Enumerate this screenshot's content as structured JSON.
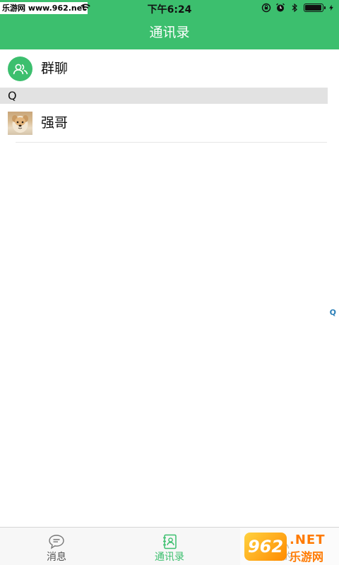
{
  "status_bar": {
    "watermark": "乐游网 www.962.net",
    "time": "下午6:24",
    "battery_level": 0.9,
    "icons": [
      "wifi-icon",
      "screen-rotation-lock-icon",
      "alarm-icon",
      "bluetooth-icon",
      "battery-icon",
      "charging-icon"
    ]
  },
  "header": {
    "title": "通讯录"
  },
  "group_chat": {
    "label": "群聊",
    "icon": "group-icon"
  },
  "sections": [
    {
      "letter": "Q",
      "contacts": [
        {
          "name": "强哥",
          "avatar": "dog-photo-avatar"
        }
      ]
    }
  ],
  "index_bar": {
    "letters": [
      "Q"
    ]
  },
  "tabbar": {
    "tabs": [
      {
        "label": "消息",
        "icon": "chat-bubble-icon",
        "active": false
      },
      {
        "label": "通讯录",
        "icon": "contacts-book-icon",
        "active": true
      },
      {
        "label": "我的",
        "icon": "person-icon",
        "active": false
      }
    ]
  },
  "watermark_bottom": {
    "badge": "962",
    "net": ".NET",
    "cn": "乐游网"
  },
  "colors": {
    "brand_green": "#3cbf6e",
    "section_bg": "#e2e2e2",
    "index_blue": "#2a7fb8"
  }
}
